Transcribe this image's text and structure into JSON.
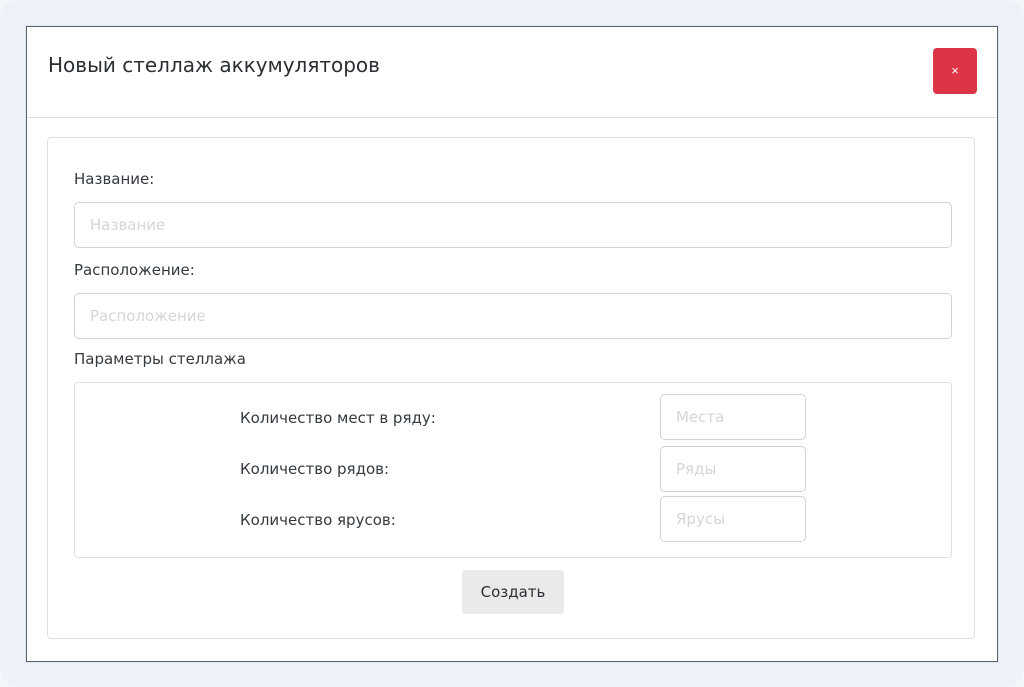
{
  "modal": {
    "title": "Новый стеллаж аккумуляторов",
    "close_label": "×"
  },
  "form": {
    "name": {
      "label": "Название:",
      "placeholder": "Название",
      "value": ""
    },
    "location": {
      "label": "Расположение:",
      "placeholder": "Расположение",
      "value": ""
    },
    "params": {
      "heading": "Параметры стеллажа",
      "places": {
        "label": "Количество мест в ряду:",
        "placeholder": "Места",
        "value": ""
      },
      "rows": {
        "label": "Количество рядов:",
        "placeholder": "Ряды",
        "value": ""
      },
      "tiers": {
        "label": "Количество ярусов:",
        "placeholder": "Ярусы",
        "value": ""
      }
    },
    "submit_label": "Создать"
  },
  "colors": {
    "close_button": "#dc3545",
    "submit_button": "#e9eaeb",
    "border": "#dcdfe3"
  }
}
